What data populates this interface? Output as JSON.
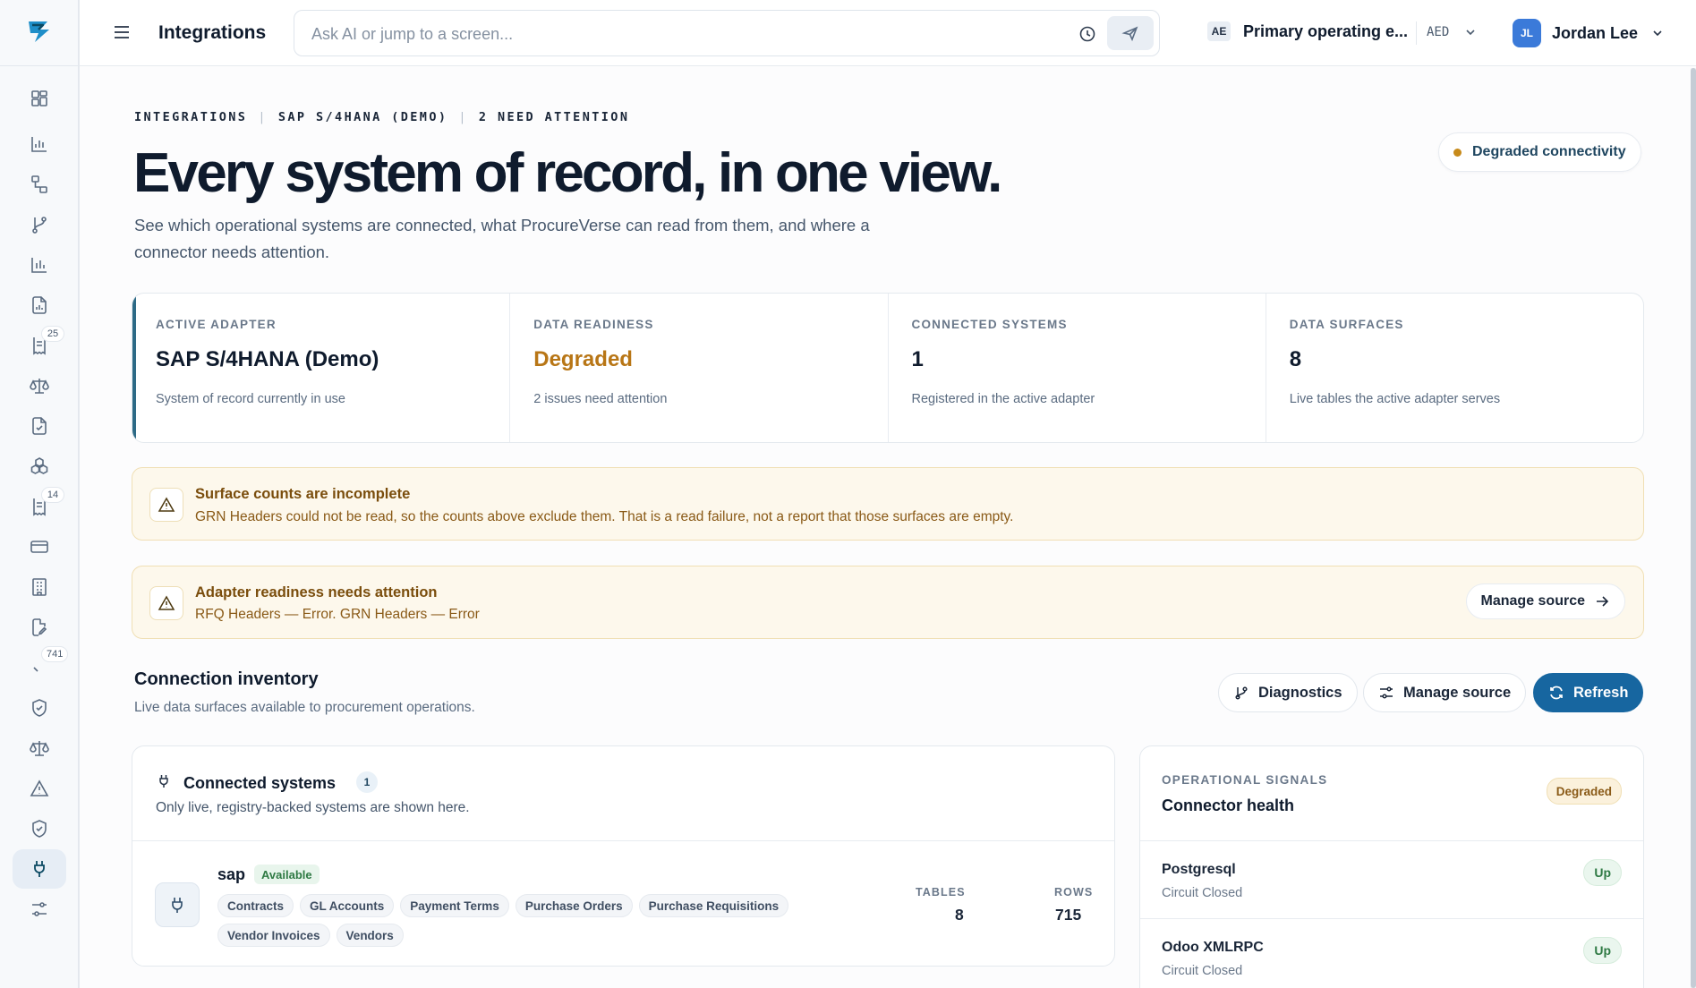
{
  "topbar": {
    "page_title": "Integrations",
    "search_placeholder": "Ask AI or jump to a screen...",
    "entity_code": "AE",
    "entity_name": "Primary operating e...",
    "currency": "AED",
    "user_initials": "JL",
    "user_name": "Jordan Lee"
  },
  "sidebar": {
    "badges": {
      "b1": "25",
      "b2": "14",
      "b3": "741"
    }
  },
  "eyebrow": {
    "part1": "INTEGRATIONS",
    "part2": "SAP S/4HANA (DEMO)",
    "part3": "2 NEED ATTENTION"
  },
  "hero": {
    "title": "Every system of record, in one view.",
    "subtitle": "See which operational systems are connected, what ProcureVerse can read from them, and where a connector needs attention."
  },
  "status_pill": "Degraded connectivity",
  "stats": [
    {
      "label": "ACTIVE ADAPTER",
      "value": "SAP S/4HANA (Demo)",
      "desc": "System of record currently in use"
    },
    {
      "label": "DATA READINESS",
      "value": "Degraded",
      "desc": "2 issues need attention"
    },
    {
      "label": "CONNECTED SYSTEMS",
      "value": "1",
      "desc": "Registered in the active adapter"
    },
    {
      "label": "DATA SURFACES",
      "value": "8",
      "desc": "Live tables the active adapter serves"
    }
  ],
  "alerts": [
    {
      "title": "Surface counts are incomplete",
      "body": "GRN Headers could not be read, so the counts above exclude them. That is a read failure, not a report that those surfaces are empty."
    },
    {
      "title": "Adapter readiness needs attention",
      "body": "RFQ Headers — Error. GRN Headers — Error",
      "button": "Manage source"
    }
  ],
  "inventory": {
    "title": "Connection inventory",
    "subtitle": "Live data surfaces available to procurement operations.",
    "buttons": {
      "diagnostics": "Diagnostics",
      "manage": "Manage source",
      "refresh": "Refresh"
    }
  },
  "systems_card": {
    "title": "Connected systems",
    "count": "1",
    "subtitle": "Only live, registry-backed systems are shown here.",
    "system": {
      "name": "sap",
      "status": "Available",
      "chips": [
        "Contracts",
        "GL Accounts",
        "Payment Terms",
        "Purchase Orders",
        "Purchase Requisitions",
        "Vendor Invoices",
        "Vendors"
      ],
      "tables_label": "TABLES",
      "tables_value": "8",
      "rows_label": "ROWS",
      "rows_value": "715"
    }
  },
  "signals_card": {
    "eyebrow": "OPERATIONAL SIGNALS",
    "title": "Connector health",
    "badge": "Degraded",
    "rows": [
      {
        "name": "Postgresql",
        "state": "Circuit Closed",
        "status": "Up"
      },
      {
        "name": "Odoo XMLRPC",
        "state": "Circuit Closed",
        "status": "Up"
      }
    ]
  }
}
